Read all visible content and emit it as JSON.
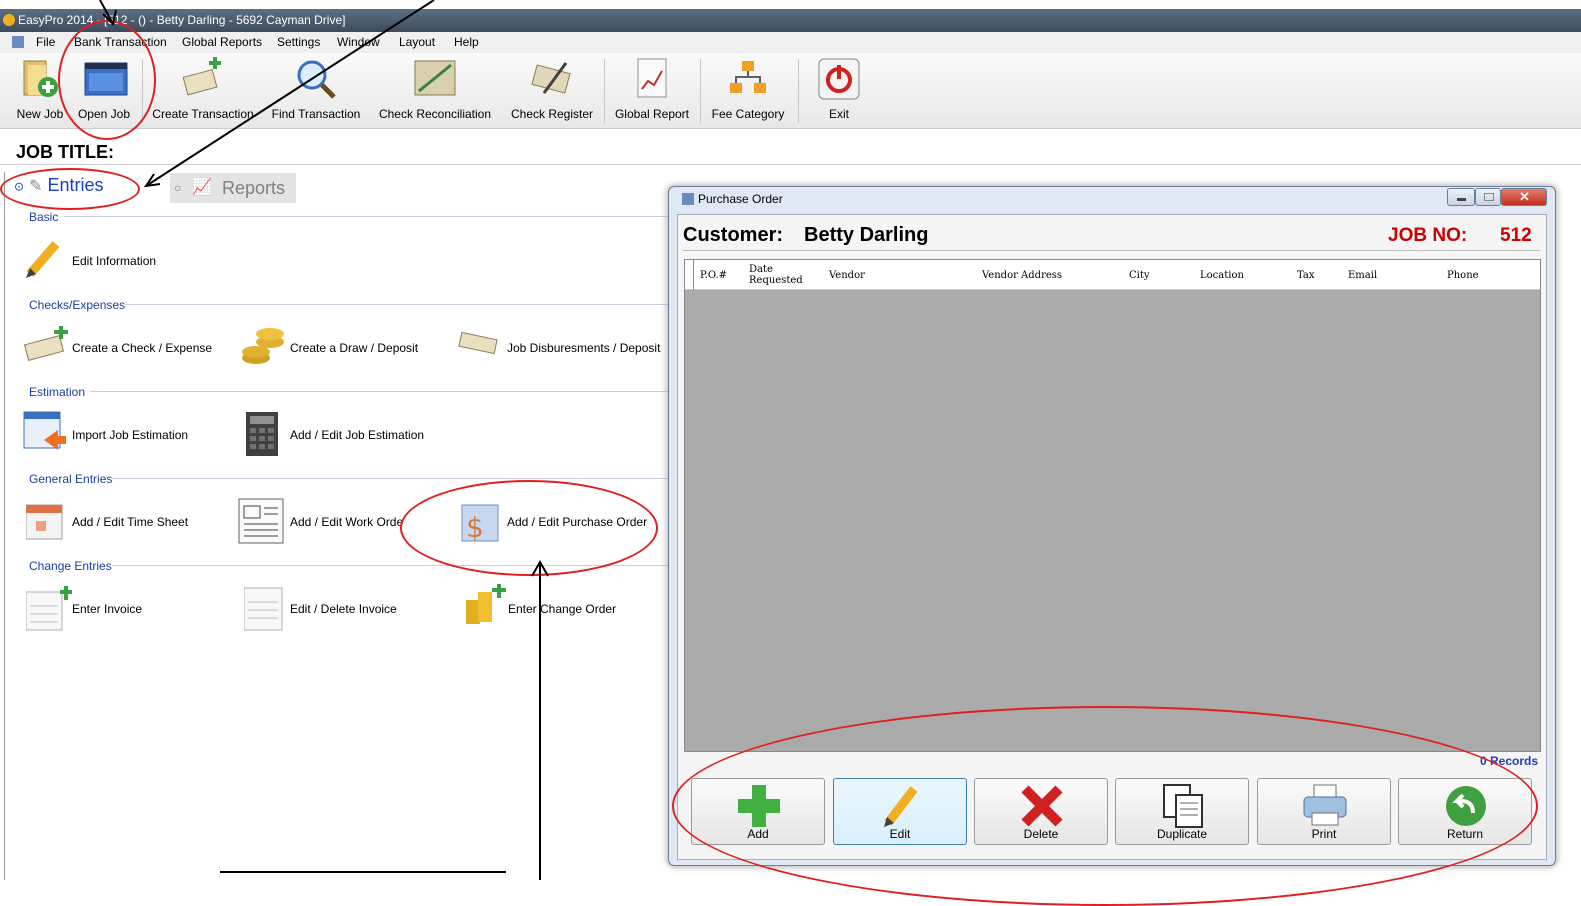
{
  "window": {
    "title": "EasyPro 2014 - [512 - () - Betty Darling - 5692 Cayman Drive]"
  },
  "menu": [
    "File",
    "Bank Transaction",
    "Global Reports",
    "Settings",
    "Window",
    "Layout",
    "Help"
  ],
  "toolbar": {
    "new_job": "New Job",
    "open_job": "Open Job",
    "create_transaction": "Create Transaction",
    "find_transaction": "Find Transaction",
    "check_reconciliation": "Check Reconciliation",
    "check_register": "Check Register",
    "global_report": "Global Report",
    "fee_category": "Fee Category",
    "exit": "Exit"
  },
  "job_title_label": "JOB TITLE:",
  "tabs": {
    "entries": "Entries",
    "reports": "Reports"
  },
  "sections": {
    "basic": "Basic",
    "checks": "Checks/Expenses",
    "estimation": "Estimation",
    "general": "General Entries",
    "change": "Change Entries"
  },
  "items": {
    "edit_information": "Edit Information",
    "create_check": "Create a Check / Expense",
    "create_draw": "Create a Draw / Deposit",
    "job_disbursements": "Job Disburesments / Deposit",
    "import_estimation": "Import Job Estimation",
    "edit_estimation": "Add / Edit Job Estimation",
    "time_sheet": "Add / Edit Time Sheet",
    "work_order": "Add / Edit Work Orde",
    "purchase_order": "Add / Edit Purchase Order",
    "enter_invoice": "Enter Invoice",
    "edit_invoice": "Edit / Delete Invoice",
    "change_order": "Enter Change Order"
  },
  "dialog": {
    "title": "Purchase Order",
    "customer_label": "Customer:",
    "customer_name": "Betty Darling",
    "job_no_label": "JOB NO:",
    "job_no": "512",
    "columns": [
      "P.O.#",
      "Date Requested",
      "Vendor",
      "Vendor Address",
      "City",
      "Location",
      "Tax",
      "Email",
      "Phone"
    ],
    "records": "0 Records",
    "buttons": {
      "add": "Add",
      "edit": "Edit",
      "delete": "Delete",
      "duplicate": "Duplicate",
      "print": "Print",
      "return": "Return"
    }
  },
  "colors": {
    "accent_red": "#cc0000",
    "entries_blue": "#1a3fbf",
    "annotation_red": "#e02020"
  }
}
